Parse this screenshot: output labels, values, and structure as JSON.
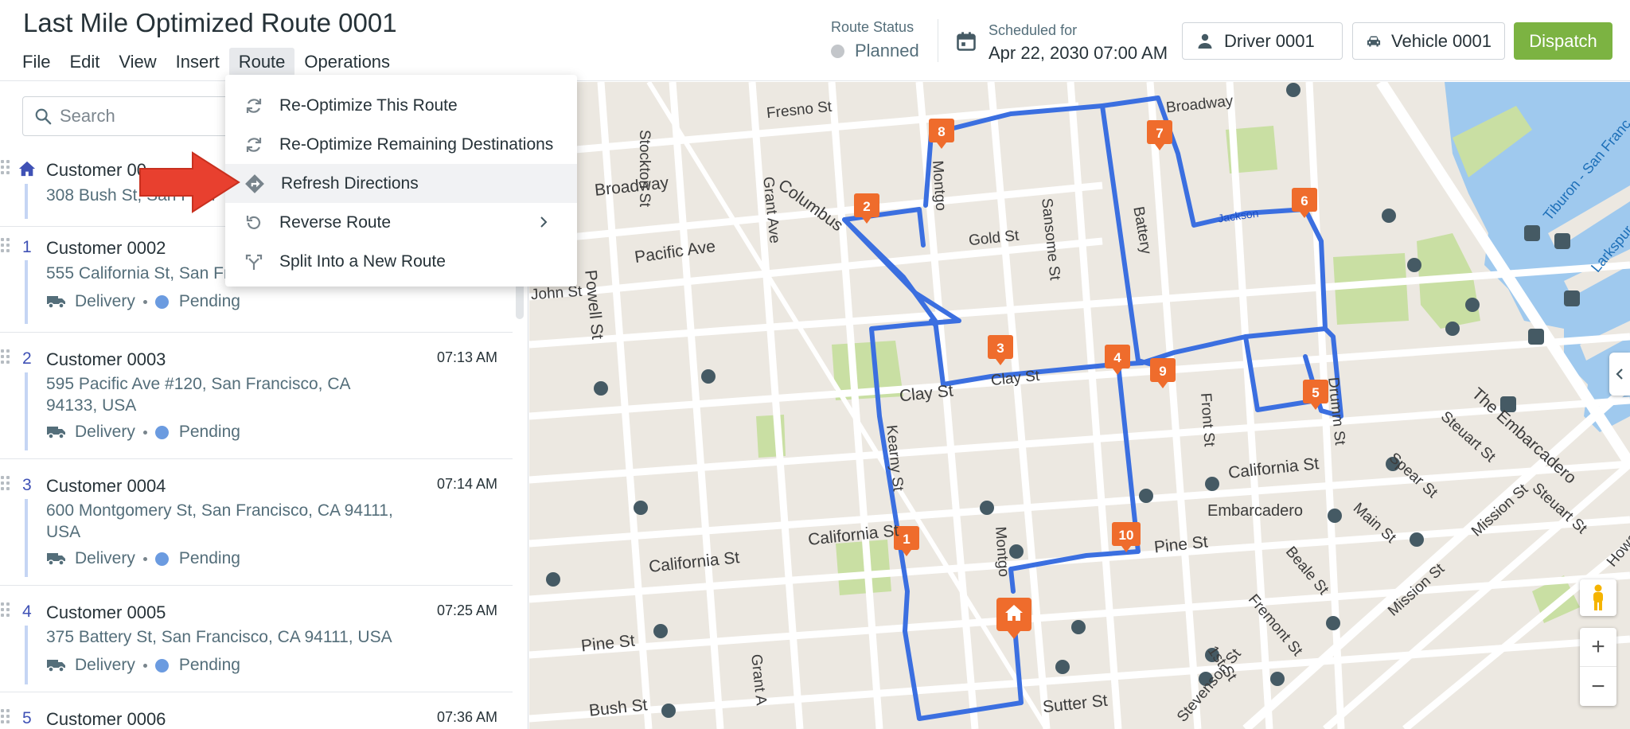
{
  "header": {
    "title": "Last Mile Optimized Route 0001",
    "menu": [
      "File",
      "Edit",
      "View",
      "Insert",
      "Route",
      "Operations"
    ],
    "active_menu": "Route",
    "route_status_label": "Route Status",
    "route_status_value": "Planned",
    "scheduled_label": "Scheduled for",
    "scheduled_value": "Apr 22, 2030 07:00 AM",
    "driver_label": "Driver 0001",
    "vehicle_label": "Vehicle 0001",
    "dispatch_label": "Dispatch",
    "colors": {
      "dispatch": "#7cb342",
      "status_planned": "#c3c6ca"
    }
  },
  "route_menu": {
    "items": [
      {
        "label": "Re-Optimize This Route",
        "icon": "refresh-icon"
      },
      {
        "label": "Re-Optimize Remaining Destinations",
        "icon": "refresh-icon"
      },
      {
        "label": "Refresh Directions",
        "icon": "directions-icon"
      },
      {
        "label": "Reverse Route",
        "icon": "undo-icon"
      },
      {
        "label": "Split Into a New Route",
        "icon": "split-icon"
      }
    ],
    "highlighted": "Refresh Directions"
  },
  "left_panel": {
    "search_placeholder": "Search",
    "stops": [
      {
        "seq": "",
        "name": "Customer 00",
        "address": "308 Bush St, San Fran",
        "time": "",
        "type": "",
        "status": ""
      },
      {
        "seq": "1",
        "name": "Customer 0002",
        "address": "555 California St, San Fr",
        "time": "",
        "type": "Delivery",
        "status": "Pending"
      },
      {
        "seq": "2",
        "name": "Customer 0003",
        "address": "595 Pacific Ave #120, San Francisco, CA 94133, USA",
        "time": "07:13 AM",
        "type": "Delivery",
        "status": "Pending"
      },
      {
        "seq": "3",
        "name": "Customer 0004",
        "address": "600 Montgomery St, San Francisco, CA 94111, USA",
        "time": "07:14 AM",
        "type": "Delivery",
        "status": "Pending"
      },
      {
        "seq": "4",
        "name": "Customer 0005",
        "address": "375 Battery St, San Francisco, CA 94111, USA",
        "time": "07:25 AM",
        "type": "Delivery",
        "status": "Pending"
      },
      {
        "seq": "5",
        "name": "Customer 0006",
        "address": "",
        "time": "07:36 AM",
        "type": "",
        "status": ""
      }
    ]
  },
  "map": {
    "street_labels": [
      "Stockton St",
      "Fresno St",
      "Broadway",
      "Columbus",
      "Grant Ave",
      "Montgo",
      "Pacific Ave",
      "Gold St",
      "Sansome St",
      "Powell St",
      "John St",
      "Clay St",
      "Clay St",
      "Kearny St",
      "California St",
      "California St",
      "California St",
      "Pine St",
      "Pine St",
      "Bush St",
      "Sutter St",
      "Grant A",
      "Montgo",
      "Battery",
      "Front St",
      "Drumm St",
      "Embarcadero",
      "The Embarcadero",
      "Steuart St",
      "Spear St",
      "Main St",
      "Beale St",
      "Fremont St",
      "1st St",
      "Mission St",
      "Steuart St",
      "Tiburon - San Franc",
      "Larkspur",
      "Broadway",
      "Jackson",
      "Mission St",
      "Stevenson St",
      "Howard"
    ],
    "markers": [
      "1",
      "2",
      "3",
      "4",
      "5",
      "6",
      "7",
      "8",
      "9",
      "10"
    ],
    "route_color": "#3b6fe0",
    "marker_color": "#ef6c2c",
    "zoom_in": "+",
    "zoom_out": "−"
  }
}
